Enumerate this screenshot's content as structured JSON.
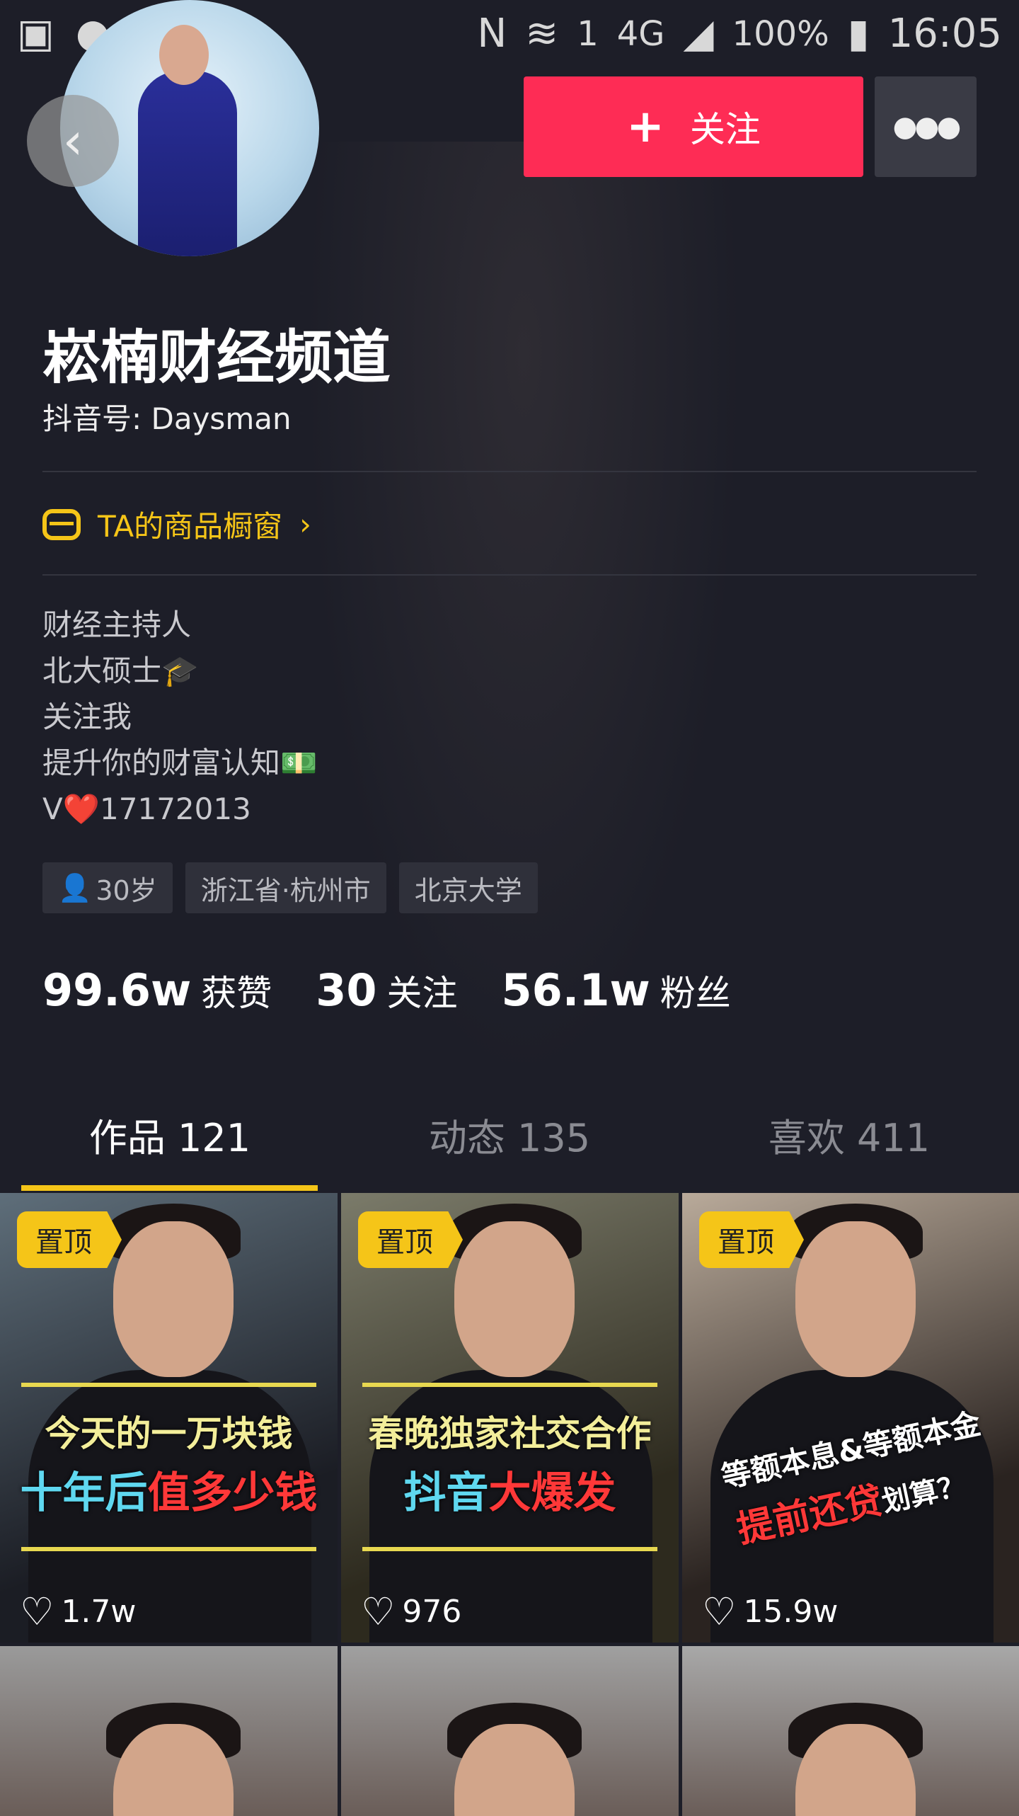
{
  "status_bar": {
    "time": "16:05",
    "battery": "100%",
    "network": "4G",
    "sim": "1"
  },
  "header": {
    "follow_label": "关注"
  },
  "profile": {
    "name": "崧楠财经频道",
    "douyin_id": "抖音号: Daysman",
    "shop_label": "TA的商品橱窗",
    "bio": [
      "财经主持人",
      "北大硕士🎓",
      "关注我",
      "提升你的财富认知💵",
      "V❤️17172013"
    ],
    "tags": [
      "30岁",
      "浙江省·杭州市",
      "北京大学"
    ]
  },
  "stats": [
    {
      "value": "99.6w",
      "label": "获赞"
    },
    {
      "value": "30",
      "label": "关注"
    },
    {
      "value": "56.1w",
      "label": "粉丝"
    }
  ],
  "tabs": [
    {
      "label": "作品 121",
      "active": true
    },
    {
      "label": "动态 135"
    },
    {
      "label": "喜欢 411"
    }
  ],
  "videos": [
    {
      "badge": "置顶",
      "caption1": "今天的一万块钱",
      "caption2a": "十年后",
      "caption2b": "值多少钱",
      "likes": "1.7w"
    },
    {
      "badge": "置顶",
      "caption1": "春晚独家社交合作",
      "caption2a": "抖音",
      "caption2b": "大爆发",
      "likes": "976"
    },
    {
      "badge": "置顶",
      "caption1": "等额本息&等额本金",
      "caption2a": "提前还贷",
      "caption2b": "划算？",
      "likes": "15.9w"
    }
  ],
  "colors": {
    "accent": "#fe2c55",
    "highlight": "#f5c518",
    "background": "#1d1e28"
  }
}
